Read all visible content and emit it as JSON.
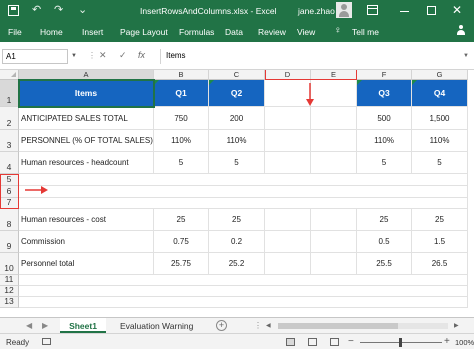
{
  "titlebar": {
    "title": "InsertRowsAndColumns.xlsx  -  Excel",
    "user": "jane.zhao",
    "close_glyph": "✕"
  },
  "ribbon": {
    "tabs": [
      "File",
      "Home",
      "Insert",
      "Page Layout",
      "Formulas",
      "Data",
      "Review",
      "View",
      "Tell me"
    ]
  },
  "formula_bar": {
    "name_box": "A1",
    "formula": "Items"
  },
  "columns": [
    "A",
    "B",
    "C",
    "D",
    "E",
    "F",
    "G"
  ],
  "rows": [
    "1",
    "2",
    "3",
    "4",
    "5",
    "6",
    "7",
    "8",
    "9",
    "10",
    "11",
    "12",
    "13"
  ],
  "cells": {
    "header": [
      "Items",
      "Q1",
      "Q2",
      "",
      "",
      "Q3",
      "Q4"
    ],
    "r2": [
      "ANTICIPATED SALES TOTAL",
      "750",
      "200",
      "",
      "",
      "500",
      "1,500"
    ],
    "r3": [
      "PERSONNEL (% OF TOTAL SALES)",
      "110%",
      "110%",
      "",
      "",
      "110%",
      "110%"
    ],
    "r4": [
      "Human resources - headcount",
      "5",
      "5",
      "",
      "",
      "5",
      "5"
    ],
    "r8": [
      "Human resources - cost",
      "25",
      "25",
      "",
      "",
      "25",
      "25"
    ],
    "r9": [
      "Commission",
      "0.75",
      "0.2",
      "",
      "",
      "0.5",
      "1.5"
    ],
    "r10": [
      "Personnel total",
      "25.75",
      "25.2",
      "",
      "",
      "25.5",
      "26.5"
    ]
  },
  "colors": {
    "excel_green": "#217346",
    "header_blue": "#1565c0",
    "annotation_red": "#e53935"
  },
  "sheets": {
    "active": "Sheet1",
    "other": "Evaluation Warning"
  },
  "status": {
    "ready": "Ready",
    "zoom": "100%"
  }
}
